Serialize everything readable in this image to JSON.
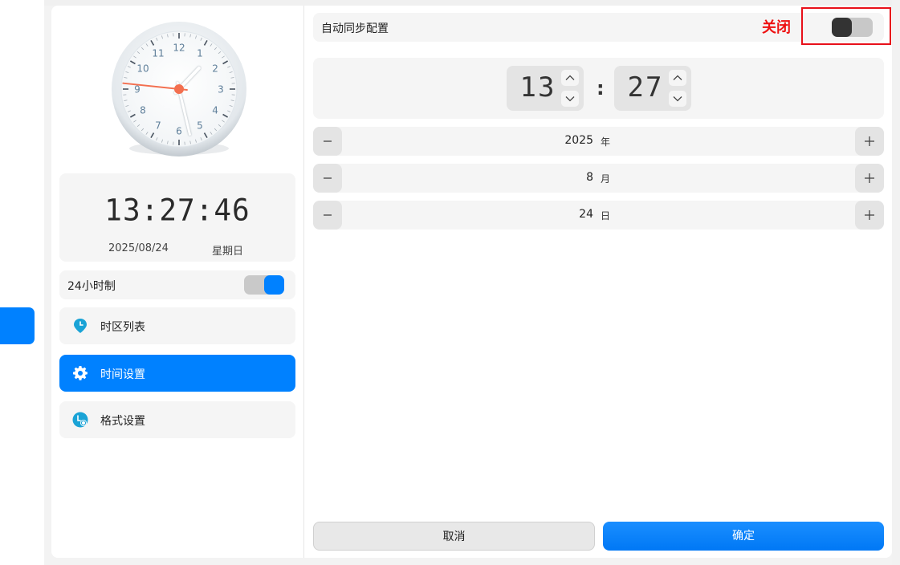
{
  "clock": {
    "numbers": [
      "12",
      "1",
      "2",
      "3",
      "4",
      "5",
      "6",
      "7",
      "8",
      "9",
      "10",
      "11"
    ],
    "hour": 13,
    "minute": 27,
    "second": 46
  },
  "digital": {
    "time": "13:27:46",
    "date": "2025/08/24",
    "weekday": "星期日"
  },
  "format24": {
    "label": "24小时制",
    "enabled": true
  },
  "nav": [
    {
      "label": "时区列表",
      "icon": "location-pin-icon",
      "active": false
    },
    {
      "label": "时间设置",
      "icon": "gear-icon",
      "active": true
    },
    {
      "label": "格式设置",
      "icon": "clock-format-icon",
      "active": false
    }
  ],
  "sync": {
    "label": "自动同步配置",
    "state_label": "关闭",
    "enabled": false
  },
  "time": {
    "hour": "13",
    "minute": "27",
    "separator": ":"
  },
  "date": {
    "year": {
      "value": "2025",
      "unit": "年"
    },
    "month": {
      "value": "8",
      "unit": "月"
    },
    "day": {
      "value": "24",
      "unit": "日"
    }
  },
  "buttons": {
    "cancel": "取消",
    "ok": "确定"
  },
  "colors": {
    "accent": "#0081ff",
    "highlight": "#e8101a",
    "second_hand": "#f36f4f"
  }
}
